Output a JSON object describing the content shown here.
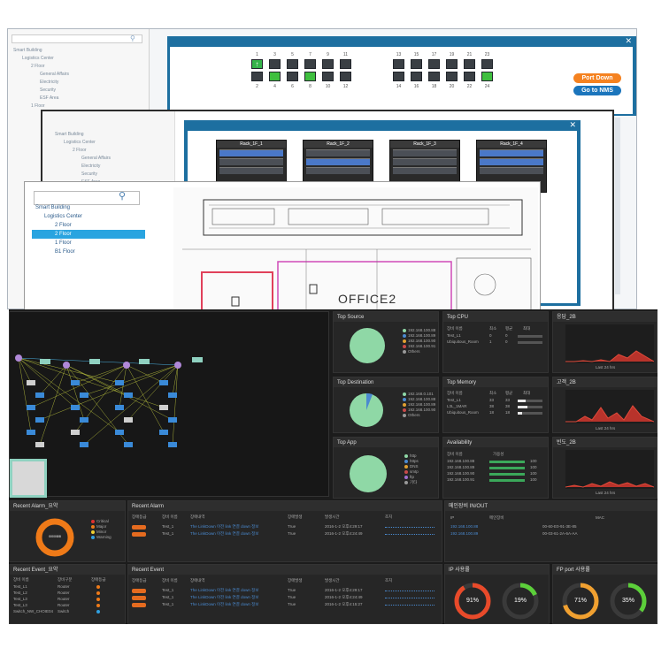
{
  "switch_panel": {
    "top_port_numbers": [
      "1",
      "3",
      "5",
      "7",
      "9",
      "11",
      "13",
      "15",
      "17",
      "19",
      "21",
      "23"
    ],
    "bottom_port_numbers": [
      "2",
      "4",
      "6",
      "8",
      "10",
      "12",
      "14",
      "16",
      "18",
      "20",
      "22",
      "24"
    ],
    "port_down_label": "Port Down",
    "go_to_nms_label": "Go to NMS",
    "tree": [
      "Smart Building",
      "Logistics Center",
      "2 Floor",
      "General Affairs",
      "Electricity",
      "Security",
      "ESF Area",
      "1 Floor"
    ]
  },
  "rack_panel": {
    "tree": [
      "Smart Building",
      "Logistics Center",
      "2 Floor",
      "General Affairs",
      "Electricity",
      "Security",
      "ESF Area"
    ],
    "racks": [
      "Rack_1F_1",
      "Rack_1F_2",
      "Rack_1F_3",
      "Rack_1F_4"
    ]
  },
  "floor_panel": {
    "tree": [
      "Smart Building",
      "Logistics Center",
      "2 Floor",
      "2 Floor",
      "1 Floor",
      "B1 Floor"
    ],
    "plan_label": "OFFICE2"
  },
  "dashboard": {
    "top_source": {
      "title": "Top Source",
      "legend": [
        "192.168.100.88",
        "192.168.100.89",
        "192.168.100.90",
        "192.168.100.91",
        "Others"
      ]
    },
    "top_destination": {
      "title": "Top Destination",
      "legend": [
        "192.168.0.101",
        "192.168.100.88",
        "192.168.100.89",
        "192.168.100.90",
        "Others"
      ]
    },
    "top_app": {
      "title": "Top App",
      "legend": [
        "http",
        "https",
        "DNS",
        "smtp",
        "ftp",
        "기타"
      ]
    },
    "top_cpu": {
      "title": "Top CPU",
      "headers": [
        "장비 이름",
        "최소",
        "평균",
        "최대"
      ],
      "rows": [
        [
          "Test_L1",
          "0",
          "0"
        ],
        [
          "Ubiquitous_Room",
          "1",
          "0"
        ]
      ]
    },
    "top_memory": {
      "title": "Top Memory",
      "headers": [
        "장비 이름",
        "최소",
        "평균",
        "최대"
      ],
      "rows": [
        [
          "Test_L1",
          "33",
          "33"
        ],
        [
          "L3L_1MAR",
          "38",
          "38"
        ],
        [
          "Ubiquitous_Room",
          "18",
          "18"
        ]
      ]
    },
    "availability": {
      "title": "Availability",
      "headers": [
        "장비 이름",
        "가용성"
      ],
      "rows": [
        [
          "192.168.100.88",
          "100"
        ],
        [
          "192.168.100.89",
          "100"
        ],
        [
          "192.168.100.90",
          "100"
        ],
        [
          "192.168.100.91",
          "100"
        ]
      ]
    },
    "chart_1": {
      "title": "응답_2B",
      "caption": "Last 24 hrs"
    },
    "chart_2": {
      "title": "고객_2B",
      "caption": "Last 24 hrs"
    },
    "chart_3": {
      "title": "빈도_2B",
      "caption": "Last 24 hrs"
    },
    "recent_alarm_summary": {
      "title": "Recent Alarm_요약",
      "legend": [
        "Critical",
        "Major",
        "Minor",
        "Warning"
      ],
      "center": "0/0/0/8/8"
    },
    "recent_alarm": {
      "title": "Recent Alarm",
      "headers": [
        "장애등급",
        "장비 이름",
        "장애내역",
        "장애발생",
        "발생시간",
        "조치"
      ],
      "rows": [
        [
          "Major",
          "Test_1",
          "The LinkDown 이전 link 연결 down 정보",
          "True",
          "2016-1-2 오후4:29:17"
        ],
        [
          "Major",
          "Test_1",
          "The LinkDown 이전 link 연결 down 정보",
          "True",
          "2016-1-2 오후4:24:49"
        ]
      ]
    },
    "recent_event_summary": {
      "title": "Recent Event_요약",
      "headers": [
        "장비 이름",
        "장비구분",
        "장애등급"
      ],
      "rows": [
        [
          "Test_L1",
          "Router"
        ],
        [
          "Test_L2",
          "Router"
        ],
        [
          "Test_L3",
          "Router"
        ],
        [
          "Test_L3",
          "Router"
        ],
        [
          "Switch_NW_CHOIE04",
          "Switch"
        ]
      ]
    },
    "recent_event": {
      "title": "Recent Event",
      "headers": [
        "장애등급",
        "장비 이름",
        "장애내역",
        "장애발생",
        "발생시간",
        "조치"
      ],
      "rows": [
        [
          "Major",
          "Test_1",
          "The LinkDown 이전 link 연결 down 정보",
          "True",
          "2016-1-2 오후4:29:17"
        ],
        [
          "Major",
          "Test_1",
          "The LinkDown 이전 link 연결 down 정보",
          "True",
          "2016-1-2 오후4:24:49"
        ],
        [
          "Major",
          "Test_1",
          "The LinkDown 이전 link 연결 down 정보",
          "True",
          "2016-1-2 오후4:15:27"
        ]
      ]
    },
    "mac_table": {
      "title": "메인장비 IN/OUT",
      "headers": [
        "IP",
        "메인장비",
        "MAC"
      ],
      "rows": [
        [
          "192.168.100.88",
          "00-60-E0-91-3E-85"
        ],
        [
          "192.168.100.89",
          "00-03-61-2A-6A-AA"
        ]
      ]
    },
    "ip_usage": {
      "title": "IP 사용률",
      "gauges": [
        "91%",
        "19%"
      ]
    },
    "ftp_usage": {
      "title": "FP port 사용률",
      "gauges": [
        "71%",
        "35%"
      ]
    }
  }
}
